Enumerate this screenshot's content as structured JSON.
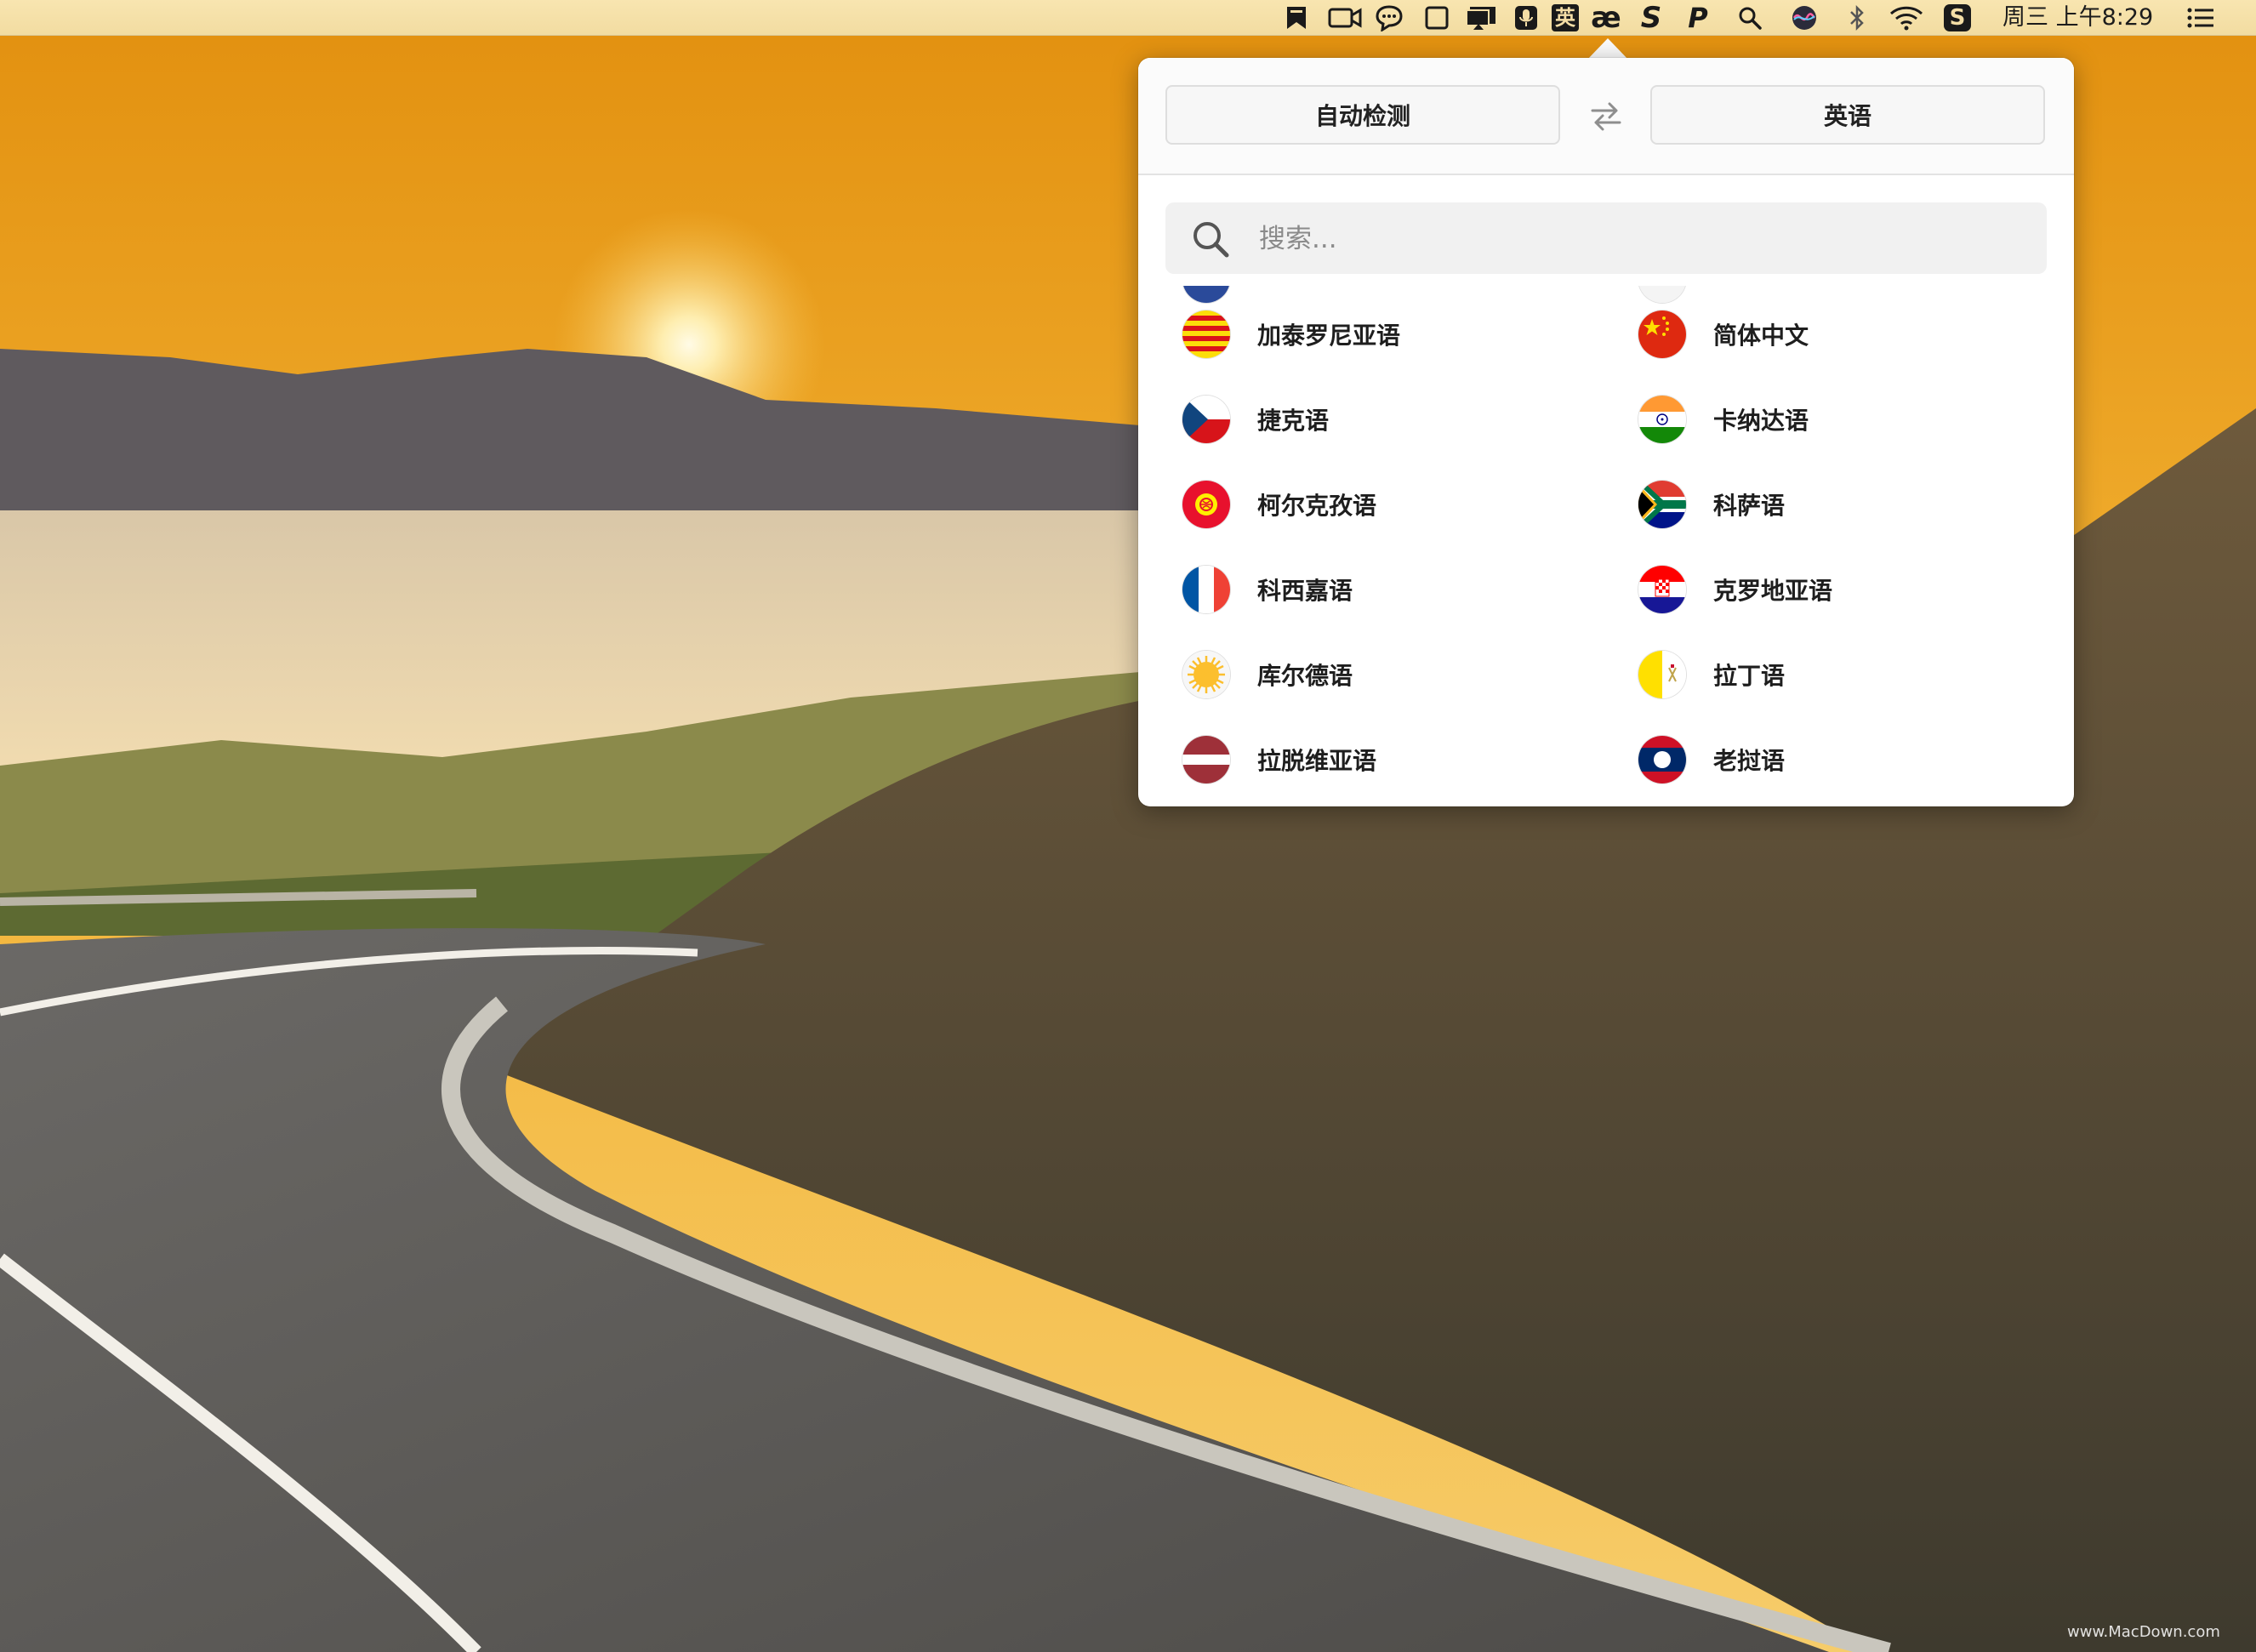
{
  "menubar": {
    "icons": [
      {
        "name": "bookmark-icon"
      },
      {
        "name": "video-camera-icon"
      },
      {
        "name": "chat-bubbles-icon"
      },
      {
        "name": "window-square-icon"
      },
      {
        "name": "airplay-display-icon"
      },
      {
        "name": "microphone-icon"
      },
      {
        "name": "input-method-icon",
        "glyph": "英"
      },
      {
        "name": "ae-ligature-icon",
        "glyph": "æ"
      },
      {
        "name": "s-app-icon",
        "glyph": "S"
      },
      {
        "name": "p-app-icon",
        "glyph": "P"
      },
      {
        "name": "spotlight-search-icon"
      },
      {
        "name": "siri-icon"
      },
      {
        "name": "bluetooth-icon"
      },
      {
        "name": "wifi-icon"
      },
      {
        "name": "sogou-icon",
        "glyph": "S"
      }
    ],
    "clock": "周三 上午8:29",
    "notification_icon": "list-icon"
  },
  "popover": {
    "source_language": "自动检测",
    "target_language": "英语",
    "swap_icon": "swap-arrows-icon",
    "search": {
      "placeholder": "搜索...",
      "value": ""
    },
    "languages": [
      {
        "label": "加泰罗尼亚语",
        "flag": "catalonia",
        "column": 0
      },
      {
        "label": "简体中文",
        "flag": "china",
        "column": 1
      },
      {
        "label": "捷克语",
        "flag": "czech",
        "column": 0
      },
      {
        "label": "卡纳达语",
        "flag": "india",
        "column": 1
      },
      {
        "label": "柯尔克孜语",
        "flag": "kyrgyzstan",
        "column": 0
      },
      {
        "label": "科萨语",
        "flag": "south-africa",
        "column": 1
      },
      {
        "label": "科西嘉语",
        "flag": "france",
        "column": 0
      },
      {
        "label": "克罗地亚语",
        "flag": "croatia",
        "column": 1
      },
      {
        "label": "库尔德语",
        "flag": "kurdistan",
        "column": 0
      },
      {
        "label": "拉丁语",
        "flag": "vatican",
        "column": 1
      },
      {
        "label": "拉脱维亚语",
        "flag": "latvia",
        "column": 0
      },
      {
        "label": "老挝语",
        "flag": "laos",
        "column": 1
      }
    ]
  },
  "watermark": "www.MacDown.com",
  "colors": {
    "menubar": "#f4dea6",
    "popover_bg": "#ffffff",
    "button_bg": "#f7f7f7",
    "search_bg": "#f1f1f1"
  }
}
